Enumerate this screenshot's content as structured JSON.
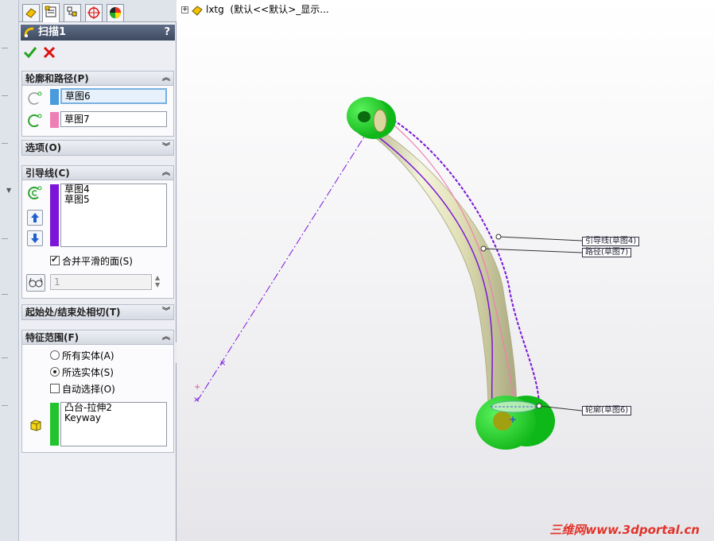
{
  "feature_tree": {
    "expander": "+",
    "root_label": "lxtg",
    "config_text": "(默认<<默认>_显示..."
  },
  "property_manager": {
    "tabs": [
      "feature-manager-icon",
      "property-manager-icon",
      "configuration-manager-icon",
      "dimxpert-icon",
      "display-manager-icon"
    ],
    "title": "扫描1",
    "help": "?",
    "groups": {
      "profile_path": {
        "title": "轮廓和路径(P)",
        "profile_value": "草图6",
        "path_value": "草图7",
        "profile_color": "#4a9bdc",
        "path_color": "#ee7fb3"
      },
      "options": {
        "title": "选项(O)"
      },
      "guide_curves": {
        "title": "引导线(C)",
        "items": [
          "草图4",
          "草图5"
        ],
        "swatch_color": "#7b16d9",
        "merge_label": "合并平滑的面(S)",
        "merge_checked": true,
        "spin_value": "1"
      },
      "tangency": {
        "title": "起始处/结束处相切(T)"
      },
      "feature_scope": {
        "title": "特征范围(F)",
        "all_bodies_label": "所有实体(A)",
        "selected_bodies_label": "所选实体(S)",
        "auto_select_label": "自动选择(O)",
        "bodies": [
          "凸台-拉伸2",
          "Keyway"
        ],
        "swatch_color": "#22c42e"
      }
    }
  },
  "callouts": {
    "guide": "引导线(草图4)",
    "path": "路径(草图7)",
    "profile": "轮廓(草图6)"
  },
  "watermark": "三维网www.3dportal.cn"
}
